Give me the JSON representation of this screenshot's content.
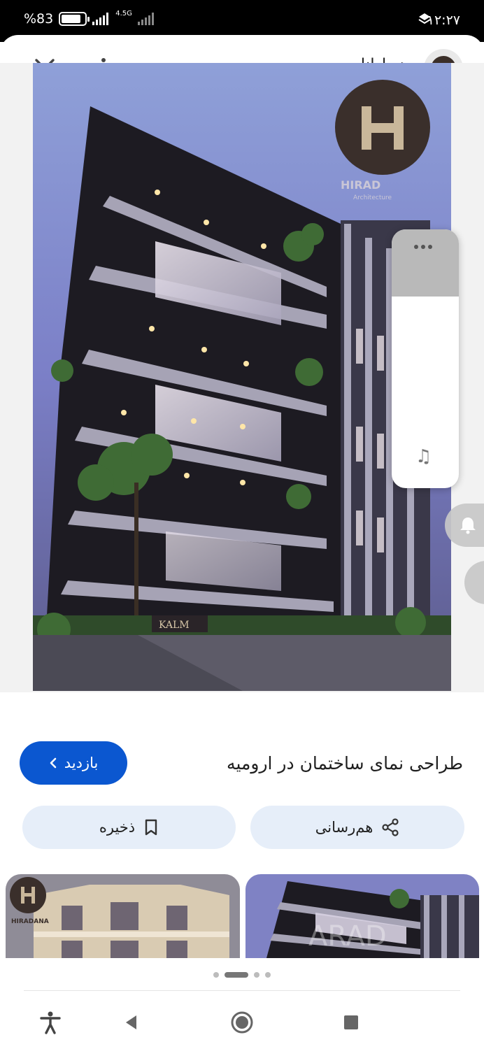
{
  "status_bar": {
    "battery_text": "%83",
    "battery_level": 0.83,
    "network_label": "4.5G",
    "time": "۱۲:۲۷"
  },
  "header": {
    "site_name": "هیرادانا",
    "close_icon": "close-icon",
    "menu_icon": "more-vert-icon"
  },
  "main_image": {
    "logo_text": "HIRAD",
    "logo_subtitle": "Architecture",
    "sign_text": "KALM"
  },
  "result": {
    "title": "طراحی نمای ساختمان در ارومیه",
    "visit_label": "بازدید"
  },
  "actions": {
    "share_label": "هم‌رسانی",
    "save_label": "ذخیره"
  },
  "related": {
    "thumb_left_logo": "HIRADANA",
    "thumb_right_watermark": "ARAD"
  },
  "pager": {
    "count": 4,
    "active_index": 1
  },
  "colors": {
    "accent": "#0b57d0",
    "chip_bg": "#e6eef9"
  }
}
